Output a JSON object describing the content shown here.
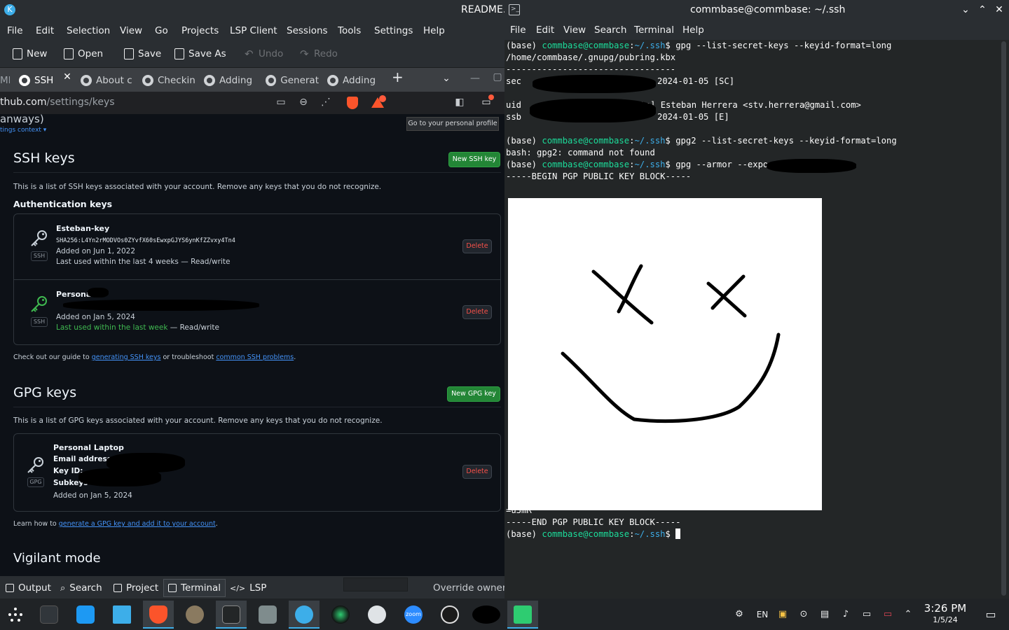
{
  "editor": {
    "title": "README.r",
    "menu": [
      "File",
      "Edit",
      "Selection",
      "View",
      "Go",
      "Projects",
      "LSP Client",
      "Sessions",
      "Tools",
      "Settings",
      "Help"
    ],
    "toolbar": {
      "new": "New",
      "open": "Open",
      "save": "Save",
      "save_as": "Save As",
      "undo": "Undo",
      "redo": "Redo"
    },
    "bottom": {
      "output": "Output",
      "search": "Search",
      "project": "Project",
      "terminal": "Terminal",
      "lsp": "LSP",
      "override": "Override owner"
    }
  },
  "browser": {
    "tabs": {
      "partial": "ME",
      "ssh": "SSH",
      "about": "About c",
      "checking": "Checkin",
      "adding1": "Adding",
      "generating": "Generat",
      "adding2": "Adding"
    },
    "url_host": "thub.com",
    "url_path": "/settings/keys",
    "tooltip": "Go to your personal profile"
  },
  "github": {
    "top_fragment": "anways)",
    "context_link": "tings context ▾",
    "ssh": {
      "heading": "SSH keys",
      "new_button": "New SSH key",
      "description": "This is a list of SSH keys associated with your account. Remove any keys that you do not recognize.",
      "auth_heading": "Authentication keys",
      "keys": [
        {
          "name": "Esteban-key",
          "fingerprint": "SHA256:L4Yn2rMODVOs0ZYvfX60sEwxpGJYS6ynKfZZvxy4Tn4",
          "added": "Added on Jun 1, 2022",
          "used": "Last used within the last 4 weeks",
          "access": " — Read/write",
          "badge": "SSH",
          "delete": "Delete"
        },
        {
          "name": "Personal",
          "added": "Added on Jan 5, 2024",
          "used": "Last used within the last week",
          "access": " — Read/write",
          "badge": "SSH",
          "delete": "Delete"
        }
      ],
      "guide_prefix": "Check out our guide to ",
      "guide_link1": "generating SSH keys",
      "guide_mid": " or troubleshoot ",
      "guide_link2": "common SSH problems",
      "guide_suffix": "."
    },
    "gpg": {
      "heading": "GPG keys",
      "new_button": "New GPG key",
      "description": "This is a list of GPG keys associated with your account. Remove any keys that you do not recognize.",
      "key": {
        "name": "Personal Laptop",
        "email_label": "Email address:",
        "keyid_label": "Key ID:",
        "subkeys_label": "Subkeys",
        "added": "Added on Jan 5, 2024",
        "badge": "GPG",
        "delete": "Delete"
      },
      "learn_prefix": "Learn how to ",
      "learn_link": "generate a GPG key and add it to your account",
      "learn_suffix": "."
    },
    "vigilant_heading": "Vigilant mode"
  },
  "terminal": {
    "title": "commbase@commbase: ~/.ssh",
    "menu": [
      "File",
      "Edit",
      "View",
      "Search",
      "Terminal",
      "Help"
    ],
    "prompt": {
      "env": "(base) ",
      "user": "commbase@commbase",
      "colon": ":",
      "path": "~/.ssh",
      "dollar": "$ "
    },
    "cmd1": "gpg --list-secret-keys --keyid-format=long",
    "keyring": "/home/commbase/.gnupg/pubring.kbx",
    "separator": "---------------------------------",
    "sec_label": "sec",
    "sec_info": "2024-01-05 [SC]",
    "uid_label": "uid",
    "uid_info": "[ultimate] Esteban Herrera <stv.herrera@gmail.com>",
    "ssb_label": "ssb",
    "ssb_info": "2024-01-05 [E]",
    "cmd2": "gpg2 --list-secret-keys --keyid-format=long",
    "err2": "bash: gpg2: command not found",
    "cmd3": "gpg --armor --export ",
    "begin_block": "-----BEGIN PGP PUBLIC KEY BLOCK-----",
    "partial_line": "=u3mR",
    "end_block": "-----END PGP PUBLIC KEY BLOCK-----"
  },
  "taskbar": {
    "lang": "EN",
    "time": "3:26 PM",
    "date": "1/5/24",
    "apps": [
      "launcher-icon",
      "settings-icon",
      "discover-icon",
      "dolphin-icon",
      "brave-icon",
      "spy-app-icon",
      "konsole-icon",
      "screenshot-icon",
      "kate-icon",
      "dark-app-icon",
      "camera-icon",
      "zoom-icon",
      "obs-icon",
      "redacted-app-icon",
      "terminal-app-icon"
    ],
    "zoom_label": "zoom"
  },
  "colors": {
    "accent": "#3daee9",
    "github_green": "#238636",
    "terminal_green": "#1cdc9a",
    "danger": "#f85149"
  }
}
